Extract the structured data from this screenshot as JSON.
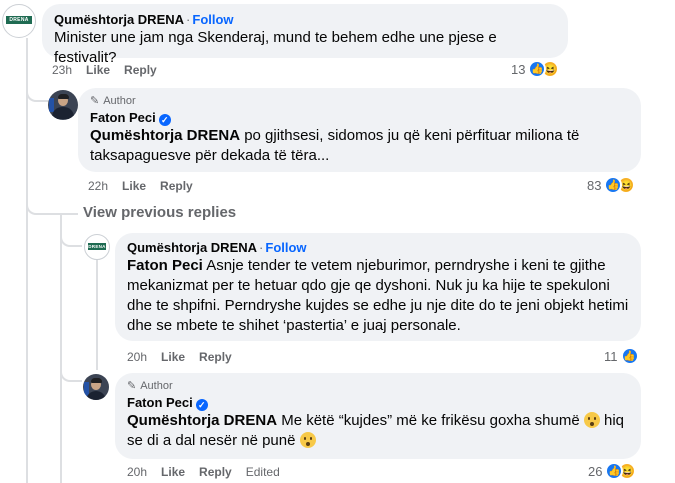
{
  "comments": [
    {
      "name": "Qumështorja DRENA",
      "follow": "Follow",
      "text": "Minister une jam nga Skenderaj, mund te behem edhe une pjese e festivalit?",
      "time": "23h",
      "like": "Like",
      "reply": "Reply",
      "reaction_count": "13",
      "avatar_text": "DRENA"
    },
    {
      "author_badge": "Author",
      "name": "Faton Peci",
      "mention": "Qumështorja DRENA",
      "text_line1": " po gjithsesi, sidomos ju që keni përfituar miliona të",
      "text_line2": "taksapaguesve për dekada të tëra...",
      "time": "22h",
      "like": "Like",
      "reply": "Reply",
      "reaction_count": "83"
    },
    {
      "name": "Qumështorja DRENA",
      "follow": "Follow",
      "mention": "Faton Peci",
      "text_line1": " Asnje tender te vetem njeburimor, perndryshe i keni te gjithe",
      "text_line2": "mekanizmat per te hetuar qdo gje qe dyshoni. Nuk ju ka hije te spekuloni",
      "text_line3": "dhe te shpifni. Perndryshe kujdes se edhe ju nje dite do te jeni objekt hetimi",
      "text_line4": "dhe se mbete te shihet ‘pastertia’ e juaj personale.",
      "time": "20h",
      "like": "Like",
      "reply": "Reply",
      "reaction_count": "11",
      "avatar_text": "DRENA"
    },
    {
      "author_badge": "Author",
      "name": "Faton Peci",
      "mention": "Qumështorja DRENA",
      "text_line1": " Me këtë “kujdes” më ke frikësu goxha shumë ",
      "text_line2a": " hiq",
      "text_line2": "se di a dal nesër në punë ",
      "time": "20h",
      "like": "Like",
      "reply": "Reply",
      "edited": "Edited",
      "reaction_count": "26"
    }
  ],
  "view_previous": "View previous replies",
  "follow_separator": "·",
  "verified_glyph": "✓",
  "like_glyph": "👍",
  "haha_glyph": "😆",
  "pen_glyph": "✎",
  "colors": {
    "link": "#0866ff",
    "bubble": "#f0f2f5",
    "meta": "#65676b",
    "like": "#1877f2"
  }
}
